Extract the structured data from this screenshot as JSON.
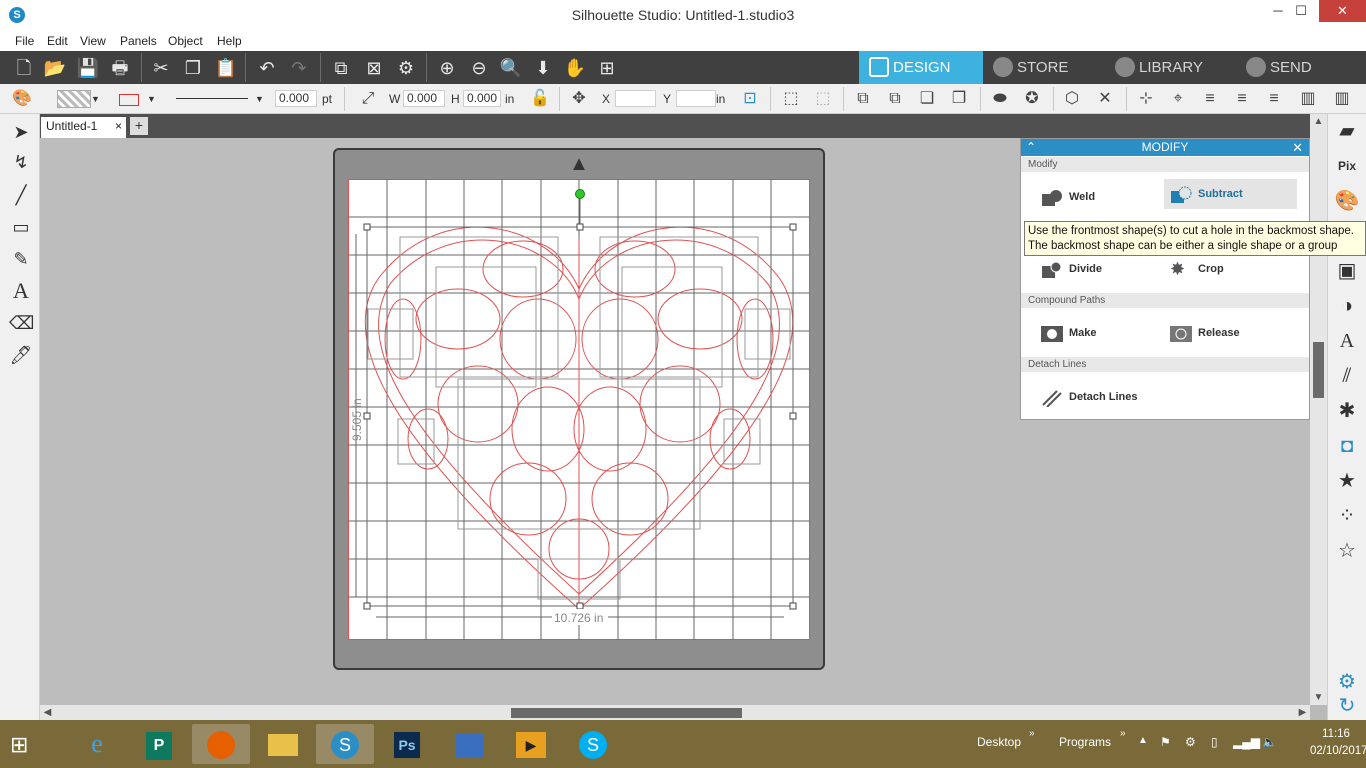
{
  "window": {
    "title": "Silhouette Studio: Untitled-1.studio3",
    "minimize": "─",
    "maximize": "☐",
    "close": "✕"
  },
  "menu": [
    "File",
    "Edit",
    "View",
    "Panels",
    "Object",
    "Help"
  ],
  "nav_tabs": {
    "design": "DESIGN",
    "store": "STORE",
    "library": "LIBRARY",
    "send": "SEND"
  },
  "properties": {
    "line_width_value": "0.000",
    "line_width_unit": "pt",
    "w_label": "W",
    "w_value": "0.000",
    "h_label": "H",
    "h_value": "0.000",
    "size_unit": "in",
    "x_label": "X",
    "x_value": "",
    "y_label": "Y",
    "y_value": "",
    "pos_unit": "in"
  },
  "document": {
    "tab_name": "Untitled-1",
    "tab_close": "×",
    "new_tab": "+",
    "height_label": "9.505 in",
    "width_label": "10.726 in"
  },
  "modify_panel": {
    "title": "MODIFY",
    "section_modify": "Modify",
    "weld": "Weld",
    "subtract": "Subtract",
    "divide": "Divide",
    "crop": "Crop",
    "section_compound": "Compound Paths",
    "make": "Make",
    "release": "Release",
    "section_detach": "Detach Lines",
    "detach_lines": "Detach Lines"
  },
  "tooltip": {
    "line1": "Use the frontmost shape(s) to cut a hole in the backmost shape.",
    "line2": "The backmost shape can be either a single shape or a group"
  },
  "taskbar": {
    "desktop": "Desktop",
    "programs": "Programs",
    "time": "11:16",
    "date": "02/10/2017"
  },
  "colors": {
    "accent": "#3eb2df",
    "panel_header": "#2b8fc5",
    "cut_line": "#e05050",
    "toolbar_dark": "#404040"
  }
}
